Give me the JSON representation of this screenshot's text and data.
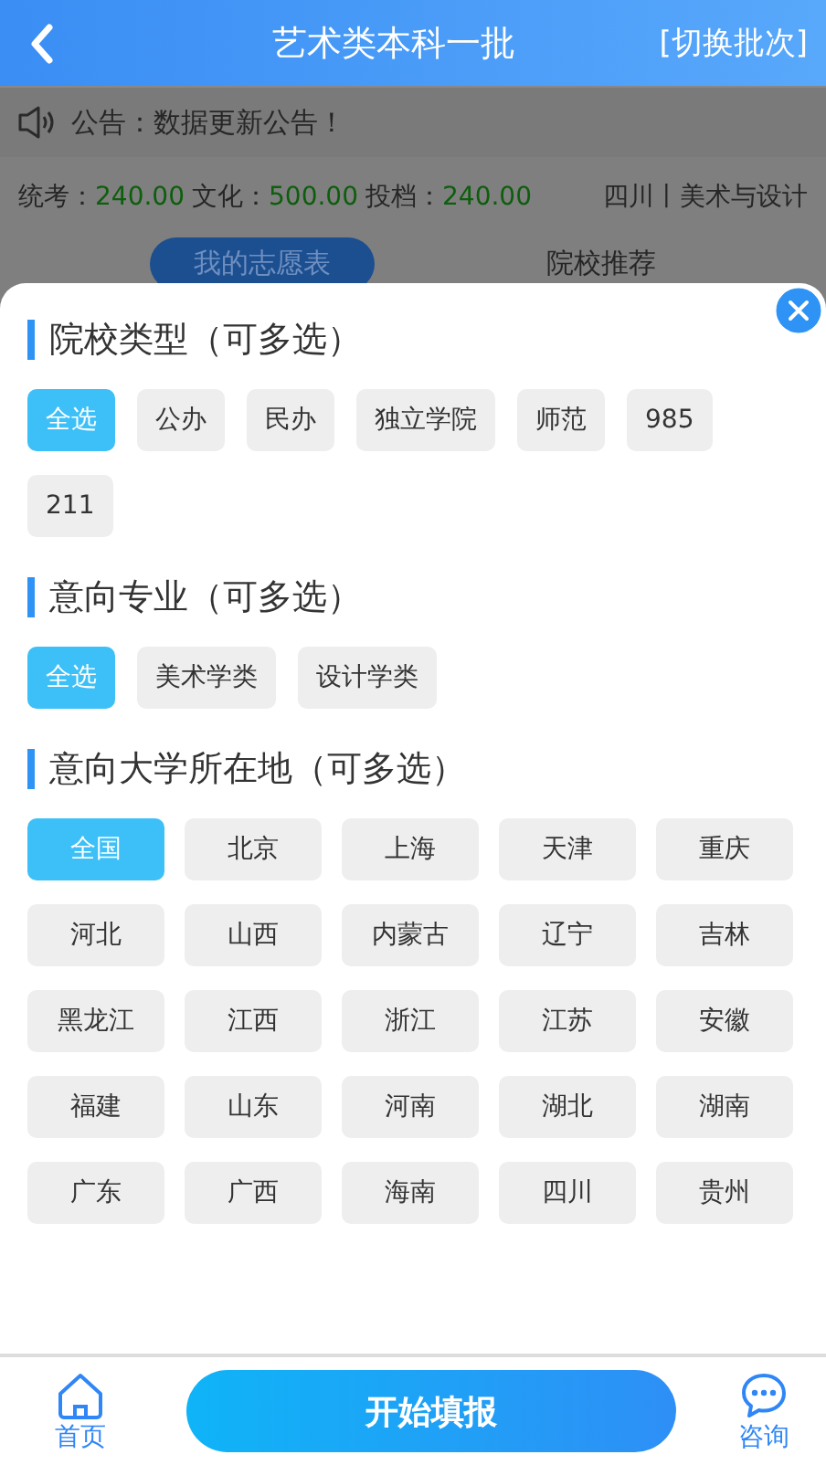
{
  "header": {
    "title": "艺术类本科一批",
    "action": "[切换批次]"
  },
  "notice": {
    "text": "公告：数据更新公告！"
  },
  "scores": [
    {
      "label": "统考：",
      "value": "240.00"
    },
    {
      "label": "文化：",
      "value": "500.00"
    },
    {
      "label": "投档：",
      "value": "240.00"
    }
  ],
  "region": "四川丨美术与设计",
  "tabs": [
    {
      "label": "我的志愿表",
      "selected": true
    },
    {
      "label": "院校推荐",
      "selected": false
    }
  ],
  "filter_sheet": {
    "sections": [
      {
        "title": "院校类型（可多选）",
        "kind": "wrap",
        "options": [
          {
            "label": "全选",
            "selected": true
          },
          {
            "label": "公办",
            "selected": false
          },
          {
            "label": "民办",
            "selected": false
          },
          {
            "label": "独立学院",
            "selected": false
          },
          {
            "label": "师范",
            "selected": false
          },
          {
            "label": "985",
            "selected": false
          },
          {
            "label": "211",
            "selected": false
          }
        ]
      },
      {
        "title": "意向专业（可多选）",
        "kind": "wrap",
        "options": [
          {
            "label": "全选",
            "selected": true
          },
          {
            "label": "美术学类",
            "selected": false
          },
          {
            "label": "设计学类",
            "selected": false
          }
        ]
      },
      {
        "title": "意向大学所在地（可多选）",
        "kind": "grid",
        "options": [
          {
            "label": "全国",
            "selected": true
          },
          {
            "label": "北京",
            "selected": false
          },
          {
            "label": "上海",
            "selected": false
          },
          {
            "label": "天津",
            "selected": false
          },
          {
            "label": "重庆",
            "selected": false
          },
          {
            "label": "河北",
            "selected": false
          },
          {
            "label": "山西",
            "selected": false
          },
          {
            "label": "内蒙古",
            "selected": false
          },
          {
            "label": "辽宁",
            "selected": false
          },
          {
            "label": "吉林",
            "selected": false
          },
          {
            "label": "黑龙江",
            "selected": false
          },
          {
            "label": "江西",
            "selected": false
          },
          {
            "label": "浙江",
            "selected": false
          },
          {
            "label": "江苏",
            "selected": false
          },
          {
            "label": "安徽",
            "selected": false
          },
          {
            "label": "福建",
            "selected": false
          },
          {
            "label": "山东",
            "selected": false
          },
          {
            "label": "河南",
            "selected": false
          },
          {
            "label": "湖北",
            "selected": false
          },
          {
            "label": "湖南",
            "selected": false
          },
          {
            "label": "广东",
            "selected": false
          },
          {
            "label": "广西",
            "selected": false
          },
          {
            "label": "海南",
            "selected": false
          },
          {
            "label": "四川",
            "selected": false
          },
          {
            "label": "贵州",
            "selected": false
          }
        ]
      }
    ]
  },
  "bottom_bar": {
    "home": "首页",
    "primary_button": "开始填报",
    "consult": "咨询"
  }
}
